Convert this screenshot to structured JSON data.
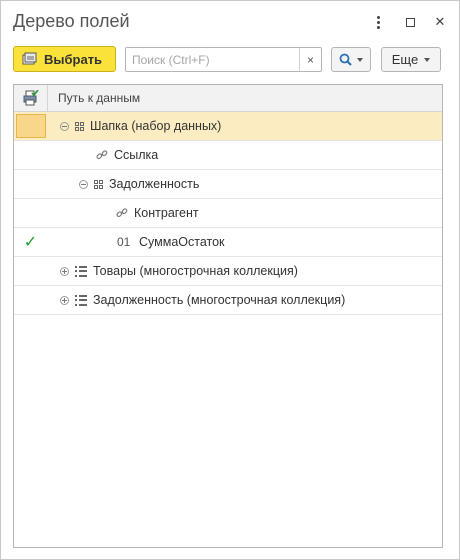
{
  "window": {
    "title": "Дерево полей",
    "controls": {
      "more_icon": "more-vertical-icon",
      "maximize_icon": "maximize-icon",
      "close_symbol": "✕"
    }
  },
  "toolbar": {
    "select_label": "Выбрать",
    "search": {
      "value": "",
      "placeholder": "Поиск (Ctrl+F)",
      "clear_symbol": "×"
    },
    "more_label": "Еще"
  },
  "table": {
    "header": "Путь к данным",
    "rows": [
      {
        "label": "Шапка (набор данных)",
        "level": 0,
        "kind": "group",
        "expanded": true,
        "selected": true,
        "checked": false
      },
      {
        "label": "Ссылка",
        "level": 1,
        "kind": "link",
        "selected": false,
        "checked": false
      },
      {
        "label": "Задолженность",
        "level": 1,
        "kind": "group",
        "expanded": true,
        "selected": false,
        "checked": false
      },
      {
        "label": "Контрагент",
        "level": 2,
        "kind": "link",
        "selected": false,
        "checked": false
      },
      {
        "label": "СуммаОстаток",
        "level": 2,
        "kind": "number",
        "prefix": "01",
        "selected": false,
        "checked": true
      },
      {
        "label": "Товары (многострочная коллекция)",
        "level": 0,
        "kind": "list",
        "expanded": false,
        "selected": false,
        "checked": false
      },
      {
        "label": "Задолженность (многострочная коллекция)",
        "level": 0,
        "kind": "list",
        "expanded": false,
        "selected": false,
        "checked": false
      }
    ]
  },
  "colors": {
    "accent_button": "#fbe23a",
    "selected_row": "#fbedc1",
    "check_mark": "#1f9a35"
  }
}
